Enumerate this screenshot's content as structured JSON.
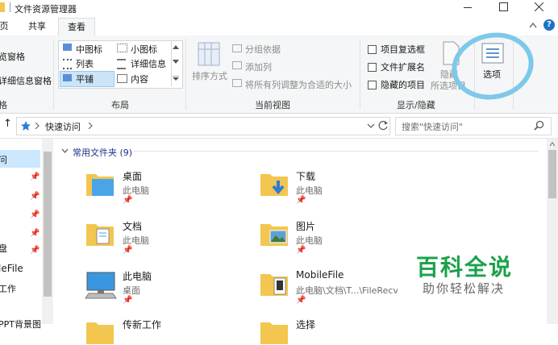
{
  "window": {
    "title": "文件资源管理器"
  },
  "tabs": [
    "页",
    "共享",
    "查看"
  ],
  "ribbon": {
    "pane": {
      "preview": "览窗格",
      "details": "详细信息窗格",
      "group": "格"
    },
    "layout": {
      "options": [
        "中图标",
        "小图标",
        "列表",
        "详细信息",
        "平铺",
        "内容"
      ],
      "selected": "平铺",
      "group": "布局"
    },
    "current_view": {
      "sort": "排序方式",
      "group_by": "分组依据",
      "add_column": "添加列",
      "fit_columns": "将所有列调整为合适的大小",
      "group": "当前视图"
    },
    "show_hide": {
      "checkboxes": [
        "项目复选框",
        "文件扩展名",
        "隐藏的项目"
      ],
      "hide": "隐藏",
      "hide_sub": "所选项目",
      "group": "显示/隐藏"
    },
    "options_label": "选项"
  },
  "address": {
    "up_arrow": "↑",
    "path": "快速访问",
    "search_placeholder": "搜索\"快速访问\""
  },
  "nav": {
    "items": [
      "问",
      "",
      "",
      "",
      "",
      "盘",
      "leFile",
      "工作",
      "PPT背景图"
    ]
  },
  "content": {
    "section_title": "常用文件夹 (9)",
    "items": [
      {
        "name": "桌面",
        "location": "此电脑"
      },
      {
        "name": "下载",
        "location": "此电脑"
      },
      {
        "name": "文档",
        "location": "此电脑"
      },
      {
        "name": "图片",
        "location": "此电脑"
      },
      {
        "name": "此电脑",
        "location": "桌面"
      },
      {
        "name": "MobileFile",
        "location": "此电脑\\文档\\T...\\FileRecv"
      },
      {
        "name": "传新工作",
        "location": ""
      },
      {
        "name": "选择",
        "location": ""
      }
    ]
  },
  "watermark": {
    "title": "百科全说",
    "subtitle": "助你轻松解决"
  },
  "colors": {
    "accent": "#1a73c8",
    "highlight_circle": "#7ec8ea",
    "watermark_green": "#1ba24b",
    "folder": "#f3c650"
  }
}
